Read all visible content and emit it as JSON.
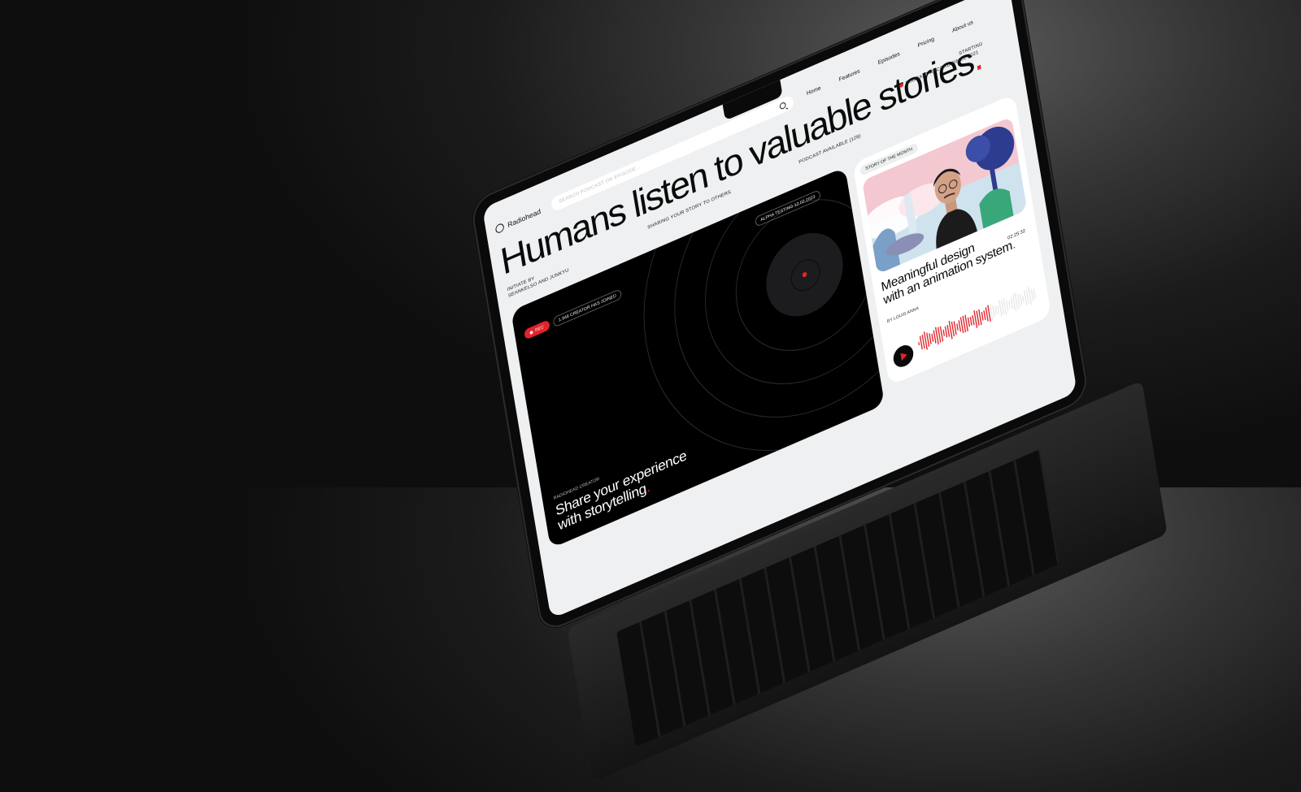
{
  "app": {
    "brand": "Radiohead"
  },
  "search": {
    "placeholder": "SEARCH PODCAST OR EPISODE..."
  },
  "nav": {
    "items": [
      "Home",
      "Features",
      "Episodes",
      "Pricing",
      "About us"
    ]
  },
  "hero": {
    "title": "Humans listen to valuable stories",
    "title_dot": ".",
    "subtitle": "SHARING YOUR STORY TO OTHERS",
    "podcast_available": "PODCAST AVAILABLE (128)",
    "starting": "STARTING",
    "record": "PODCAST RECORD SINCE 2021",
    "initiate_label": "INITIATE BY",
    "initiate_names": "SEANKELSO AND JUNKYU"
  },
  "dark_card": {
    "alpha_badge": "ALPHA TESTING 12.02.2023",
    "rec_label": "REC",
    "joined_badge": "1.948 CREATOR HAS JOINED",
    "creator_label": "RADIOHEAD CREATOR",
    "headline_line1": "Share your experience",
    "headline_line2": "with storytelling",
    "headline_dot": "."
  },
  "story_card": {
    "tag": "STORY OF THE MONTH",
    "title_line1": "Meaningful design",
    "title_line2": "with an animation system",
    "title_dot": ".",
    "author": "BY LOUIS ANNA",
    "duration": "02:25:32"
  },
  "colors": {
    "accent": "#e0242a",
    "screen_bg": "#eef0f1",
    "dark": "#0a0a0a"
  },
  "icons": [
    "search-icon",
    "play-icon",
    "record-dot-icon",
    "brand-logo-icon"
  ]
}
